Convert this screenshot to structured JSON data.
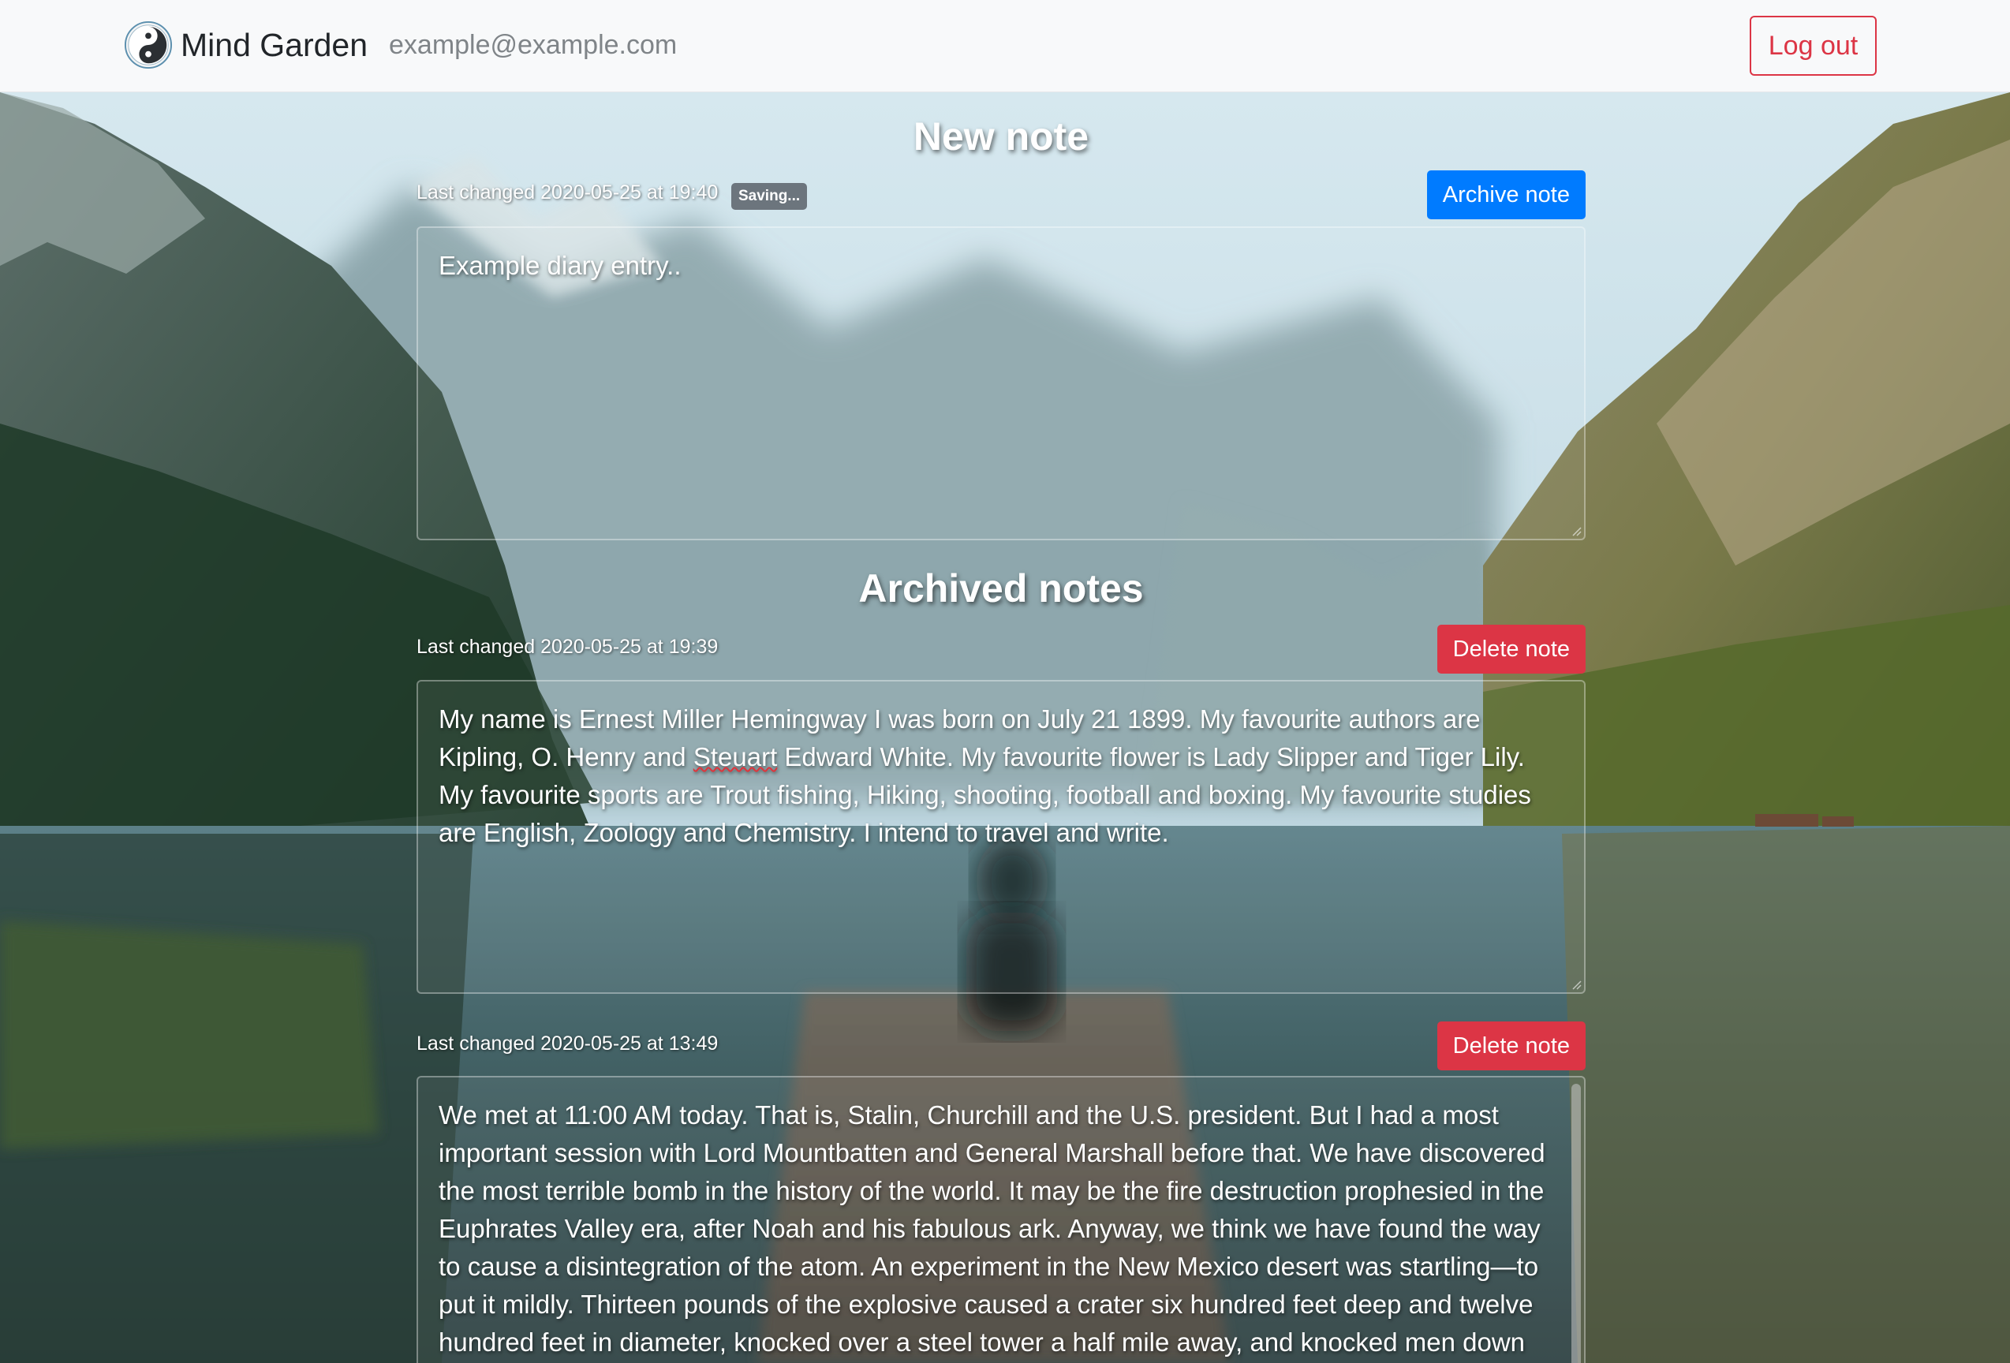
{
  "app": {
    "brand_name": "Mind Garden",
    "user_email": "example@example.com",
    "logout_label": "Log out",
    "logo_icon": "yin-yang-icon"
  },
  "new_note": {
    "title": "New note",
    "last_changed": "Last changed 2020-05-25 at 19:40",
    "status_badge": "Saving...",
    "archive_label": "Archive note",
    "text": "Example diary entry.."
  },
  "archived": {
    "title": "Archived notes",
    "notes": [
      {
        "last_changed": "Last changed 2020-05-25 at 19:39",
        "delete_label": "Delete note",
        "text_before": "My name is Ernest Miller Hemingway I was born on July 21 1899. My favourite authors are Kipling, O. Henry and ",
        "misspelled": "Steuart",
        "text_after": " Edward White. My favourite flower is Lady Slipper and Tiger Lily. My favourite sports are Trout fishing, Hiking, shooting, football and boxing. My favourite studies are English, Zoology and Chemistry. I intend to travel and write."
      },
      {
        "last_changed": "Last changed 2020-05-25 at 13:49",
        "delete_label": "Delete note",
        "text": "We met at 11:00 AM today. That is, Stalin, Churchill and the U.S. president. But I had a most important session with Lord Mountbatten and General Marshall before that. We have discovered the most terrible bomb in the history of the world. It may be the fire destruction prophesied in the Euphrates Valley era, after Noah and his fabulous ark. Anyway, we think we have found the way to cause a disintegration of the atom. An experiment in the New Mexico desert was startling—to put it mildly. Thirteen pounds of the explosive caused a crater six hundred feet deep and twelve hundred feet in diameter, knocked over a steel tower a half mile away, and knocked men down ten thousand"
      }
    ]
  },
  "colors": {
    "primary": "#007bff",
    "danger": "#dc3545",
    "secondary": "#6c757d",
    "navbar_bg": "#f8f9fa"
  }
}
